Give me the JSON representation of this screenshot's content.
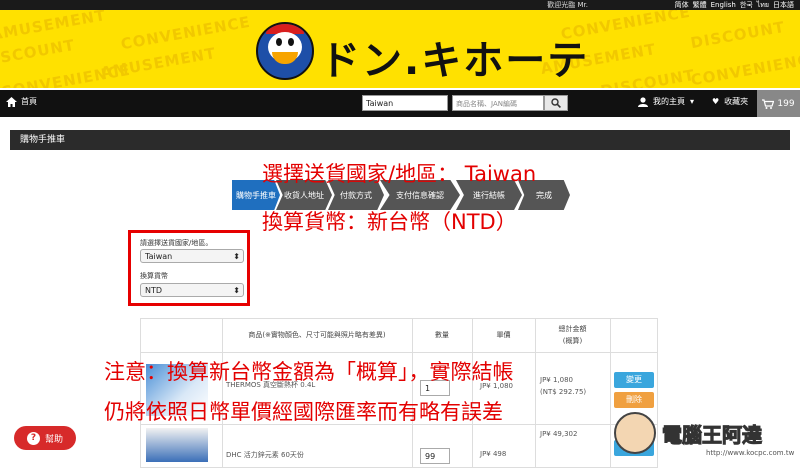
{
  "topbar": {
    "greeting": "歡迎光臨 Mr.",
    "languages": [
      "简体",
      "繁體",
      "English",
      "한국",
      "ไทย",
      "日本語"
    ]
  },
  "banner": {
    "background_words": [
      "DISCOUNT",
      "AMUSEMENT",
      "CONVENIENCE"
    ],
    "logo_text": "ドン.キホーテ"
  },
  "nav": {
    "home_label": "首頁",
    "region_value": "Taiwan",
    "search_placeholder": "商品名稱、JAN編碼",
    "my_page_label": "我的主頁",
    "favorites_label": "收藏夾",
    "cart_count": "199"
  },
  "section": {
    "title": "購物手推車"
  },
  "steps": [
    "購物手推車",
    "收貨人地址",
    "付款方式",
    "支付信息確認",
    "進行結帳",
    "完成"
  ],
  "overlay": {
    "line1": "選擇送貨國家/地區： Taiwan",
    "line2": "換算貨幣：新台幣（NTD）",
    "note1": "注意：換算新台幣金額為「概算」，實際結帳",
    "note2": "仍將依照日幣單價經國際匯率而有略有誤差"
  },
  "form": {
    "country_label": "請選擇送貨國家/地區。",
    "country_value": "Taiwan",
    "currency_label": "換算貨幣",
    "currency_value": "NTD"
  },
  "table": {
    "headers": {
      "product": "商品(※實物顏色、尺寸可能與照片略有差異)",
      "qty": "數量",
      "price": "單價",
      "total_line1": "總計金額",
      "total_line2": "(概算)"
    },
    "rows": [
      {
        "name": "THERMOS 真空斷熱杯 0.4L",
        "qty": "1",
        "price": "JP¥ 1,080",
        "total": "JP¥ 1,080",
        "total_ntd": "(NT$ 292.75)",
        "edit": "變更",
        "delete": "刪除"
      },
      {
        "name": "DHC 活力鋅元素 60天份",
        "qty": "99",
        "price": "JP¥ 498",
        "total": "JP¥ 49,302"
      }
    ]
  },
  "help": {
    "label": "幫助"
  },
  "watermark": {
    "text": "電腦王阿達",
    "url": "http://www.kocpc.com.tw"
  },
  "colors": {
    "banner_yellow": "#ffe100",
    "step_active": "#1f6fbf",
    "annotation_red": "#e30000",
    "edit_btn": "#3aa6dd",
    "delete_btn": "#f0a040"
  }
}
